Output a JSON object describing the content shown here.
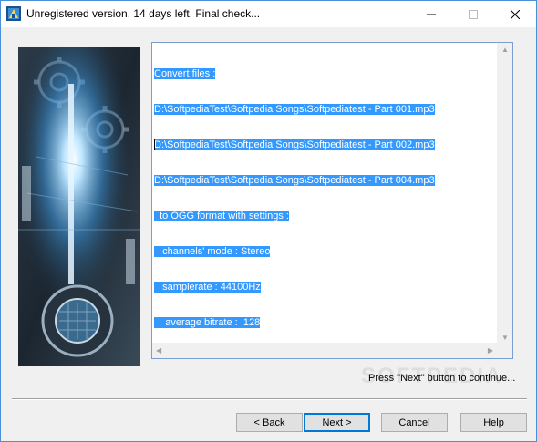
{
  "window": {
    "title": "Unregistered version. 14 days left. Final check...",
    "controls": {
      "minimize": "—",
      "maximize": "☐",
      "close": "✕"
    }
  },
  "log": {
    "lines": [
      "Convert files :",
      "D:\\SoftpediaTest\\Softpedia Songs\\Softpediatest - Part 001.mp3",
      "D:\\SoftpediaTest\\Softpedia Songs\\Softpediatest - Part 002.mp3",
      "D:\\SoftpediaTest\\Softpedia Songs\\Softpediatest - Part 004.mp3",
      "  to OGG format with settings :",
      "   channels' mode : Stereo",
      "   samplerate : 44100Hz",
      "    average bitrate :  128"
    ]
  },
  "hint": "Press \"Next\" button to continue...",
  "watermark": "SOFTPEDIA",
  "buttons": {
    "back": "< Back",
    "next": "Next >",
    "cancel": "Cancel",
    "help": "Help"
  },
  "colors": {
    "selection": "#3399ff",
    "accent": "#0078d7"
  }
}
